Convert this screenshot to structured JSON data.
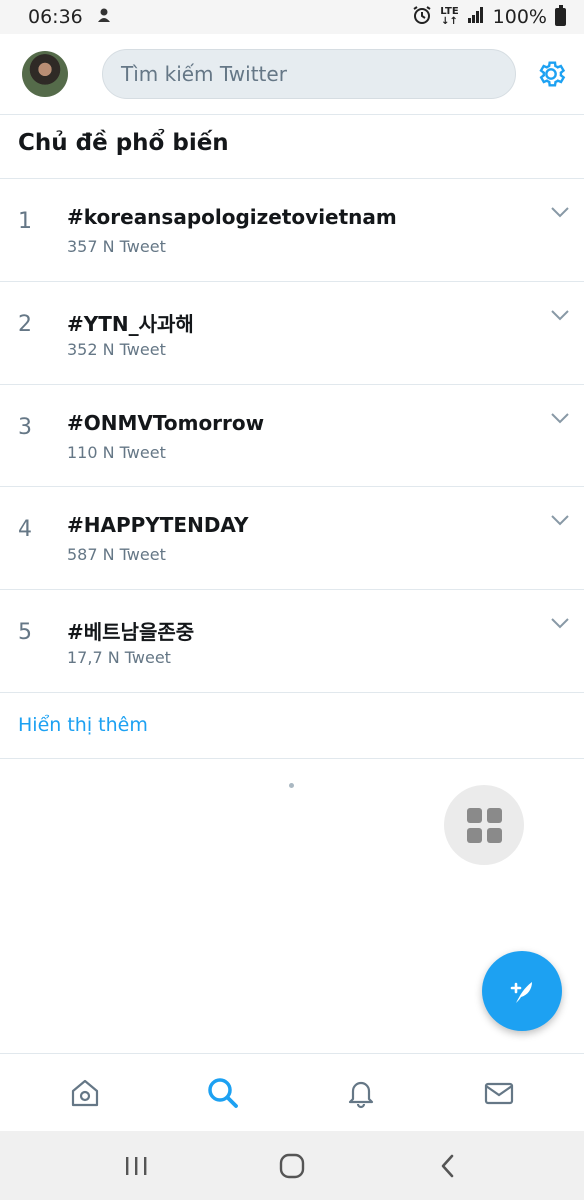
{
  "status_bar": {
    "time": "06:36",
    "network": "LTE",
    "battery": "100%"
  },
  "header": {
    "search_placeholder": "Tìm kiếm Twitter"
  },
  "section": {
    "title": "Chủ đề phổ biến"
  },
  "trends": [
    {
      "rank": "1",
      "name": "#koreansapologizetovietnam",
      "count": "357 N Tweet"
    },
    {
      "rank": "2",
      "name": "#YTN_사과해",
      "count": "352 N Tweet"
    },
    {
      "rank": "3",
      "name": "#ONMVTomorrow",
      "count": "110 N Tweet"
    },
    {
      "rank": "4",
      "name": "#HAPPYTENDAY",
      "count": "587 N Tweet"
    },
    {
      "rank": "5",
      "name": "#베트남을존중",
      "count": "17,7 N Tweet"
    }
  ],
  "show_more": "Hiển thị thêm",
  "colors": {
    "accent": "#1da1f2",
    "text_secondary": "#657786",
    "divider": "#e1e8ed"
  },
  "bottom_nav": {
    "items": [
      "home-icon",
      "search-icon",
      "bell-icon",
      "mail-icon"
    ],
    "active": "search-icon"
  }
}
